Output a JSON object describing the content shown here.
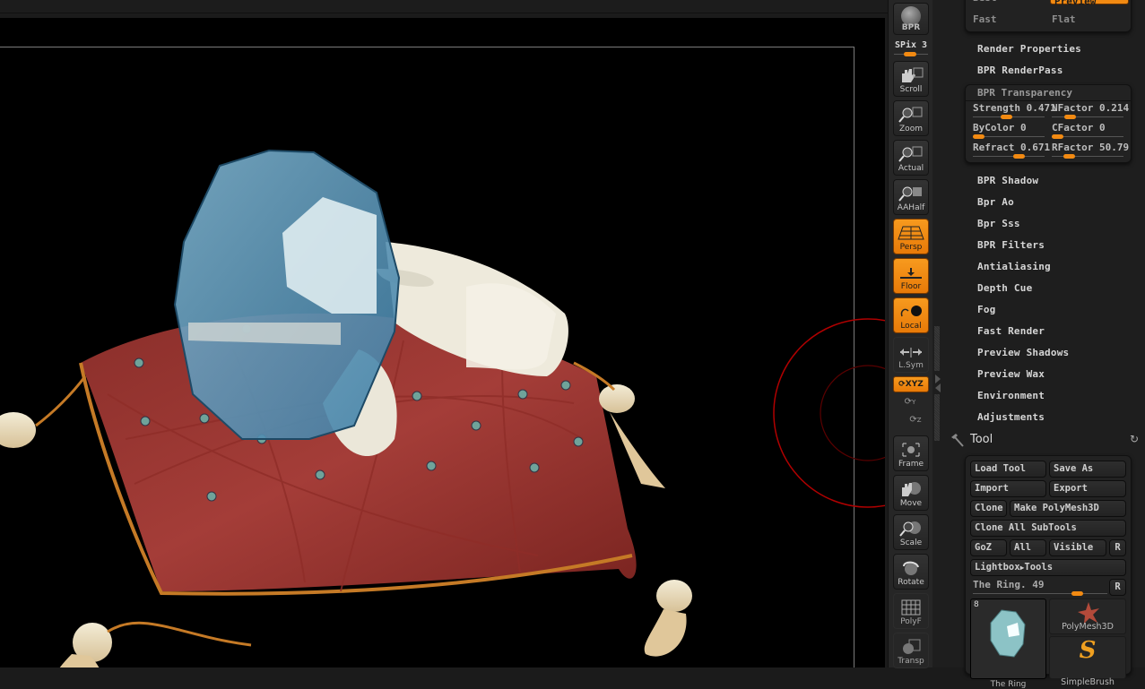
{
  "shelf": {
    "bpr_label": "BPR",
    "spix_label": "SPix 3",
    "spix_value_fraction": 0.45,
    "buttons": [
      {
        "id": "scroll",
        "label": "Scroll",
        "active": false
      },
      {
        "id": "zoom",
        "label": "Zoom",
        "active": false
      },
      {
        "id": "actual",
        "label": "Actual",
        "active": false
      },
      {
        "id": "aahalf",
        "label": "AAHalf",
        "active": false
      },
      {
        "id": "persp",
        "label": "Persp",
        "active": true
      },
      {
        "id": "floor",
        "label": "Floor",
        "active": true
      },
      {
        "id": "local",
        "label": "Local",
        "active": true
      },
      {
        "id": "lsym",
        "label": "L.Sym",
        "active": false
      },
      {
        "id": "frame",
        "label": "Frame",
        "active": false
      },
      {
        "id": "move",
        "label": "Move",
        "active": false
      },
      {
        "id": "scale",
        "label": "Scale",
        "active": false
      },
      {
        "id": "rotate",
        "label": "Rotate",
        "active": false
      },
      {
        "id": "polyf",
        "label": "PolyF",
        "active": false
      },
      {
        "id": "transp",
        "label": "Transp",
        "active": false
      }
    ],
    "xyz_label": "XYZ",
    "y_label": "Y",
    "z_label": "Z"
  },
  "render_panel": {
    "top_box": {
      "partial_label_left": "Best",
      "partial_label_right": "Preview",
      "fast": "Fast",
      "flat": "Flat"
    },
    "items_before": [
      "Render Properties",
      "BPR RenderPass"
    ],
    "transparency": {
      "title": "BPR Transparency",
      "sliders": [
        {
          "label": "Strength",
          "value": "0.471",
          "fraction": 0.47
        },
        {
          "label": "NFactor",
          "value": "0.2142",
          "fraction": 0.21
        },
        {
          "label": "ByColor",
          "value": "0",
          "fraction": 0.0
        },
        {
          "label": "CFactor",
          "value": "0",
          "fraction": 0.0
        },
        {
          "label": "Refract",
          "value": "0.6714",
          "fraction": 0.67
        },
        {
          "label": "RFactor",
          "value": "50.79",
          "fraction": 0.2
        }
      ]
    },
    "items_after": [
      "BPR Shadow",
      "Bpr Ao",
      "Bpr Sss",
      "BPR Filters",
      "Antialiasing",
      "Depth Cue",
      "Fog",
      "Fast Render",
      "Preview Shadows",
      "Preview Wax",
      "Environment",
      "Adjustments"
    ]
  },
  "tool_panel": {
    "title": "Tool",
    "buttons": {
      "load_tool": "Load Tool",
      "save_as": "Save As",
      "import": "Import",
      "export": "Export",
      "clone": "Clone",
      "make_polymesh": "Make PolyMesh3D",
      "clone_all": "Clone All SubTools",
      "goz": "GoZ",
      "all": "All",
      "visible": "Visible",
      "r": "R",
      "lightbox": "Lightbox",
      "lightbox_tools": "Tools"
    },
    "current_tool": "The Ring. 49",
    "current_tool_fraction": 0.8,
    "reset_label": "R",
    "thumbnails": [
      {
        "name": "The Ring",
        "count": "8"
      },
      {
        "name": "PolyMesh3D"
      },
      {
        "name": "SimpleBrush"
      }
    ]
  },
  "colors": {
    "accent": "#f28a12",
    "panel_bg": "#1e1e1e",
    "viewport_bg": "#000000",
    "gizmo_red": "#b00000"
  }
}
